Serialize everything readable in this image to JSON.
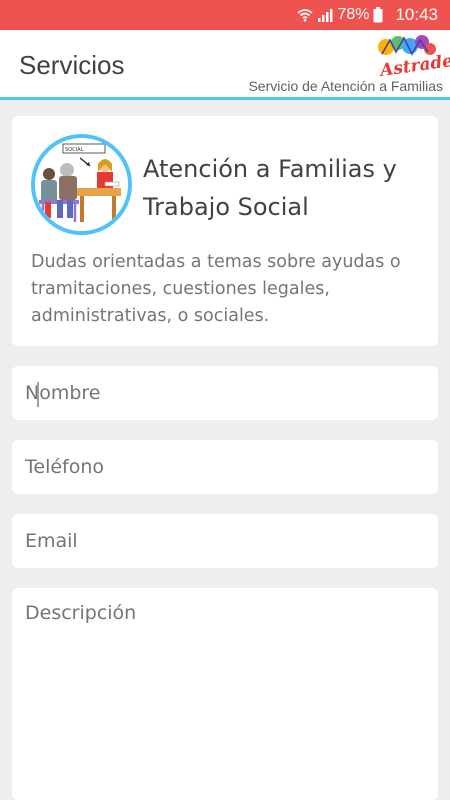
{
  "status_bar": {
    "battery": "78%",
    "time": "10:43",
    "icons": [
      "wifi-icon",
      "signal-icon",
      "battery-icon"
    ]
  },
  "app_bar": {
    "title": "Servicios",
    "subtitle": "Servicio de Atención a Familias",
    "logo_text": "Astrade"
  },
  "service_card": {
    "title": "Atención a Familias y Trabajo Social",
    "description": "Dudas orientadas a temas sobre ayudas o tramitaciones, cuestiones legales, administrativas,  o sociales.",
    "image_label": "SOCIAL"
  },
  "form": {
    "name_placeholder": "Nombre",
    "phone_placeholder": "Teléfono",
    "email_placeholder": "Email",
    "description_placeholder": "Descripción"
  },
  "colors": {
    "status_bar": "#ef5350",
    "accent": "#4fc3f7",
    "background": "#eeeeee"
  }
}
